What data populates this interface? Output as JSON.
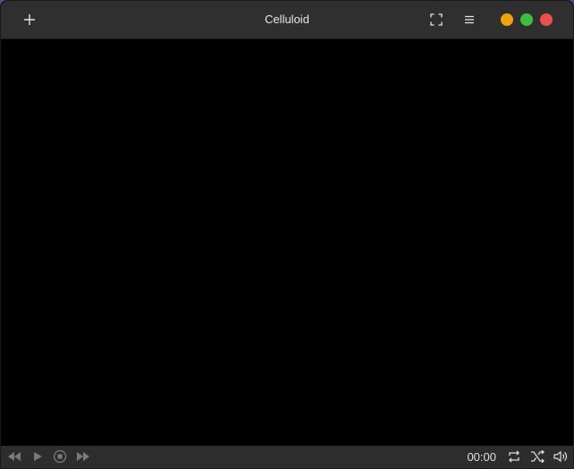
{
  "window": {
    "title": "Celluloid"
  },
  "headerbar": {
    "new_icon": "plus-icon",
    "fullscreen_icon": "fullscreen-icon",
    "menu_icon": "hamburger-menu-icon",
    "window_controls": {
      "minimize_color": "#f0a30a",
      "maximize_color": "#3cbf3c",
      "close_color": "#e8524a"
    }
  },
  "controls": {
    "previous_icon": "rewind-icon",
    "play_icon": "play-icon",
    "stop_icon": "stop-icon",
    "next_icon": "fast-forward-icon",
    "time": "00:00",
    "loop_icon": "repeat-icon",
    "shuffle_icon": "shuffle-icon",
    "volume_icon": "volume-icon",
    "disabled_color": "#7a7a7a",
    "enabled_color": "#e0e0e0"
  }
}
